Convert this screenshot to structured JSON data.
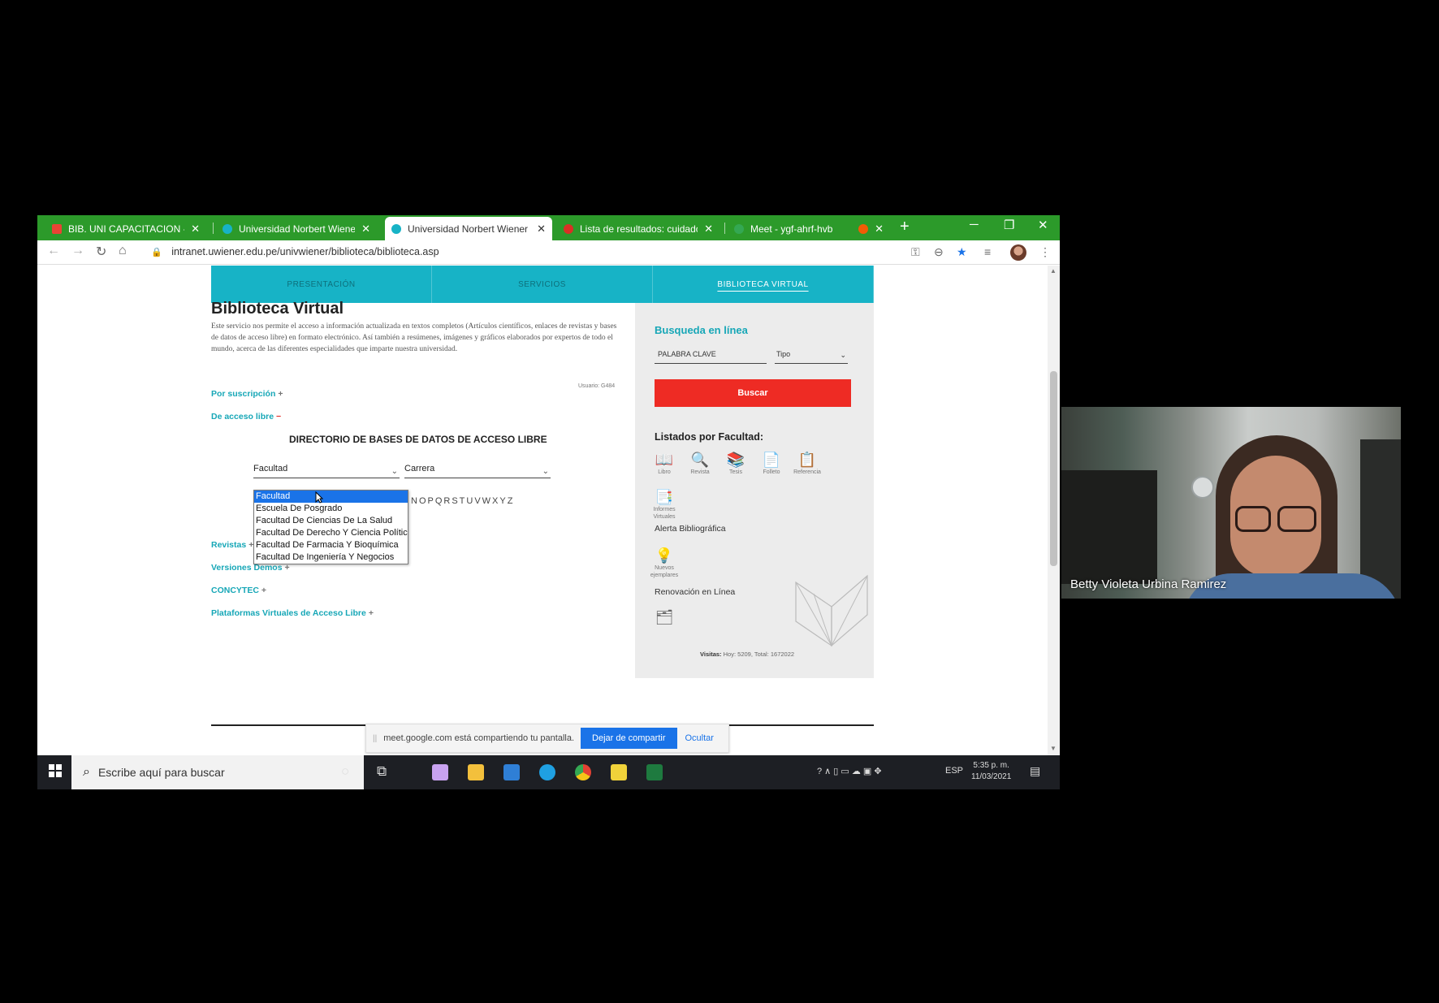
{
  "browser": {
    "tabs": [
      {
        "title": "BIB. UNI CAPACITACION - ges",
        "favicon_color": "#ea4335"
      },
      {
        "title": "Universidad Norbert Wiener",
        "favicon_color": "#17b3c6"
      },
      {
        "title": "Universidad Norbert Wiener",
        "favicon_color": "#17b3c6"
      },
      {
        "title": "Lista de resultados: cuidados c",
        "favicon_color": "#d93025"
      },
      {
        "title": "Meet - ygf-ahrf-hvb",
        "favicon_color": "#34a853"
      }
    ],
    "tab_close": "✕",
    "new_tab": "+",
    "window_controls": {
      "minimize": "─",
      "restore": "❐",
      "close": "✕"
    },
    "url": "intranet.uwiener.edu.pe/univwiener/biblioteca/biblioteca.asp",
    "nav_icons": {
      "back": "←",
      "forward": "→",
      "reload": "↻",
      "home": "⌂",
      "lock": "🔒"
    },
    "toolbar_icons": {
      "key": "⚿",
      "zoom": "⊖",
      "star": "★",
      "media": "≡",
      "menu": "⋮"
    }
  },
  "page": {
    "nav": [
      "PRESENTACIÓN",
      "SERVICIOS",
      "BIBLIOTECA VIRTUAL"
    ],
    "title": "Biblioteca Virtual",
    "intro": "Este servicio nos permite el acceso a información actualizada en textos completos (Artículos científicos, enlaces de revistas y bases de datos de acceso libre) en formato electrónico. Así también a resúmenes, imágenes y gráficos elaborados por expertos de todo el mundo, acerca de las diferentes especialidades que imparte nuestra universidad.",
    "usuario": "Usuario: G484",
    "links": {
      "suscripcion": "Por suscripción",
      "acceso_libre": "De acceso libre",
      "revistas": "Revistas",
      "versiones_demos": "Versiones Demos",
      "concytec": "CONCYTEC",
      "plataformas": "Plataformas Virtuales de Acceso Libre"
    },
    "plus": "+",
    "minus": "−",
    "directory_title": "DIRECTORIO DE BASES DE DATOS DE ACCESO LIBRE",
    "facultad_select": "Facultad",
    "carrera_select": "Carrera",
    "chevron": "⌄",
    "alphabet": "NOPQRSTUVWXYZ",
    "facultad_options": [
      "Facultad",
      "Escuela De Posgrado",
      "Facultad De Ciencias De La Salud",
      "Facultad De Derecho Y Ciencia Política",
      "Facultad De Farmacia Y Bioquímica",
      "Facultad De Ingeniería Y Negocios"
    ],
    "selected_option": 0
  },
  "sidebar": {
    "search_title": "Busqueda en línea",
    "keyword_placeholder": "PALABRA CLAVE",
    "type_placeholder": "Tipo",
    "search_button": "Buscar",
    "listados_title": "Listados por Facultad:",
    "icons": [
      {
        "label": "Libro",
        "glyph": "📖"
      },
      {
        "label": "Revista",
        "glyph": "🔍"
      },
      {
        "label": "Tesis",
        "glyph": "📚"
      },
      {
        "label": "Folleto",
        "glyph": "📄"
      },
      {
        "label": "Referencia",
        "glyph": "📋"
      },
      {
        "label": "Informes Virtuales",
        "glyph": "📑"
      }
    ],
    "alerta": "Alerta Bibliográfica",
    "nuevos": {
      "label": "Nuevos ejemplares",
      "glyph": "💡"
    },
    "renovacion": "Renovación en Línea",
    "renovacion_glyph": "🗂",
    "visitas_label": "Visitas:",
    "visitas_value": "Hoy: 5209, Total: 1672022"
  },
  "sharebar": {
    "text": "meet.google.com está compartiendo tu pantalla.",
    "stop": "Dejar de compartir",
    "hide": "Ocultar",
    "grip": "||"
  },
  "taskbar": {
    "search_placeholder": "Escribe aquí para buscar",
    "search_icon": "⌕",
    "cortana": "○",
    "taskview": "⧉",
    "apps": [
      {
        "name": "paint",
        "color": "#c8a2f0"
      },
      {
        "name": "explorer",
        "color": "#f3c03c"
      },
      {
        "name": "mail",
        "color": "#2f7fd6"
      },
      {
        "name": "edge",
        "color": "#1fa0e2"
      },
      {
        "name": "chrome",
        "color": "#e34133"
      },
      {
        "name": "sticky",
        "color": "#f0d23a"
      },
      {
        "name": "excel",
        "color": "#1e7a3f"
      }
    ],
    "tray": "? ∧ ▯ ▭ ☁ ▣ ✥",
    "language": "ESP",
    "time": "5:35 p. m.",
    "date": "11/03/2021",
    "notifications": "▤"
  },
  "webcam": {
    "participant": "Betty Violeta Urbina Ramirez"
  }
}
